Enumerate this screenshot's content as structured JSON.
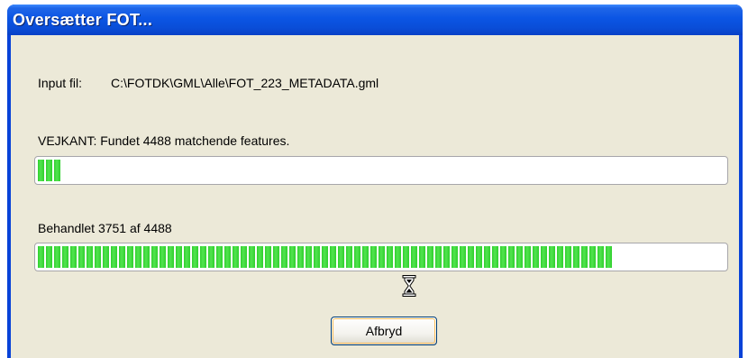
{
  "window": {
    "title": "Oversætter FOT..."
  },
  "input": {
    "label": "Input fil:",
    "value": "C:\\FOTDK\\GML\\Alle\\FOT_223_METADATA.gml"
  },
  "feature_status": {
    "text": "VEJKANT: Fundet 4488 matchende features.",
    "progress_fraction": 0.03
  },
  "processed_status": {
    "text": "Behandlet 3751 af 4488",
    "progress_fraction": 0.84
  },
  "cursor": {
    "icon": "hourglass-icon"
  },
  "buttons": {
    "cancel_label": "Afbryd"
  },
  "colors": {
    "title_bar": "#0a4ed8",
    "progress_fill": "#30cf2e",
    "dialog_bg": "#ece9d8"
  }
}
